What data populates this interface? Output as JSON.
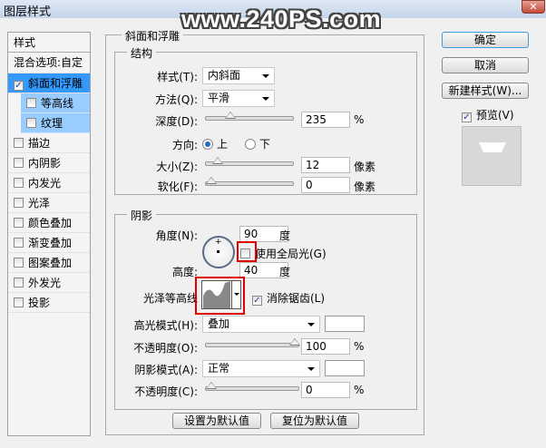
{
  "window": {
    "title": "图层样式",
    "close": "✕"
  },
  "watermark": "www.240PS.com",
  "sidebar": {
    "header": "样式",
    "blend": "混合选项:自定",
    "items": [
      {
        "label": "斜面和浮雕",
        "checked": true
      },
      {
        "label": "等高线",
        "checked": false
      },
      {
        "label": "纹理",
        "checked": false
      },
      {
        "label": "描边",
        "checked": false
      },
      {
        "label": "内阴影",
        "checked": false
      },
      {
        "label": "内发光",
        "checked": false
      },
      {
        "label": "光泽",
        "checked": false
      },
      {
        "label": "颜色叠加",
        "checked": false
      },
      {
        "label": "渐变叠加",
        "checked": false
      },
      {
        "label": "图案叠加",
        "checked": false
      },
      {
        "label": "外发光",
        "checked": false
      },
      {
        "label": "投影",
        "checked": false
      }
    ]
  },
  "bevel": {
    "title": "斜面和浮雕",
    "structure": {
      "title": "结构",
      "style_label": "样式(T):",
      "style_value": "内斜面",
      "technique_label": "方法(Q):",
      "technique_value": "平滑",
      "depth_label": "深度(D):",
      "depth_value": "235",
      "depth_unit": "%",
      "depth_fraction": 0.24,
      "direction_label": "方向:",
      "dir_up": "上",
      "dir_down": "下",
      "direction": "up",
      "size_label": "大小(Z):",
      "size_value": "12",
      "size_unit": "像素",
      "size_fraction": 0.08,
      "soften_label": "软化(F):",
      "soften_value": "0",
      "soften_unit": "像素",
      "soften_fraction": 0
    },
    "shading": {
      "title": "阴影",
      "angle_label": "角度(N):",
      "angle_value": "90",
      "angle_unit": "度",
      "global_light": "使用全局光(G)",
      "global_light_checked": false,
      "altitude_label": "高度:",
      "altitude_value": "40",
      "altitude_unit": "度",
      "gloss_label": "光泽等高线",
      "anti_alias": "消除锯齿(L)",
      "anti_alias_checked": true,
      "highlight_label": "高光模式(H):",
      "highlight_mode": "叠加",
      "highlight_color": "#ffffff",
      "opacity1_label": "不透明度(O):",
      "opacity1_value": "100",
      "opacity1_unit": "%",
      "opacity1_fraction": 1.0,
      "shadow_label": "阴影模式(A):",
      "shadow_mode": "正常",
      "shadow_color": "#ffffff",
      "opacity2_label": "不透明度(C):",
      "opacity2_value": "0",
      "opacity2_unit": "%",
      "opacity2_fraction": 0
    },
    "make_default": "设置为默认值",
    "reset_default": "复位为默认值"
  },
  "right": {
    "ok": "确定",
    "cancel": "取消",
    "new_style": "新建样式(W)...",
    "preview": "预览(V)",
    "preview_checked": true
  }
}
